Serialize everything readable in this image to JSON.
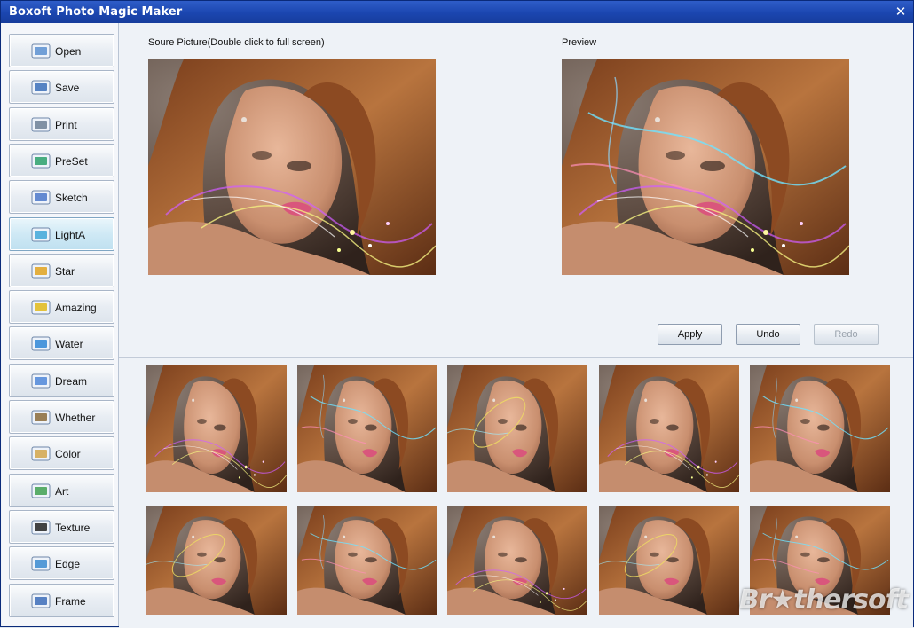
{
  "window": {
    "title": "Boxoft Photo Magic Maker"
  },
  "sidebar": {
    "items": [
      {
        "label": "Open",
        "icon": "folder-icon"
      },
      {
        "label": "Save",
        "icon": "floppy-icon"
      },
      {
        "label": "Print",
        "icon": "printer-icon"
      },
      {
        "label": "PreSet",
        "icon": "preset-icon"
      },
      {
        "label": "Sketch",
        "icon": "sketch-icon"
      },
      {
        "label": "LightA",
        "icon": "light-icon",
        "active": true
      },
      {
        "label": "Star",
        "icon": "star-icon"
      },
      {
        "label": "Amazing",
        "icon": "amazing-icon"
      },
      {
        "label": "Water",
        "icon": "water-icon"
      },
      {
        "label": "Dream",
        "icon": "dream-icon"
      },
      {
        "label": "Whether",
        "icon": "weather-icon"
      },
      {
        "label": "Color",
        "icon": "color-icon"
      },
      {
        "label": "Art",
        "icon": "art-icon"
      },
      {
        "label": "Texture",
        "icon": "texture-icon"
      },
      {
        "label": "Edge",
        "icon": "edge-icon"
      },
      {
        "label": "Frame",
        "icon": "frame-icon"
      }
    ]
  },
  "preview": {
    "source_caption": "Soure Picture(Double click to full screen)",
    "preview_caption": "Preview"
  },
  "actions": {
    "apply": "Apply",
    "undo": "Undo",
    "redo": "Redo"
  },
  "thumbnails": {
    "count": 10
  },
  "watermark": "Br★thersoft",
  "colors": {
    "titlebar": "#1b46b0",
    "accent_active": "#cfe9f5"
  }
}
